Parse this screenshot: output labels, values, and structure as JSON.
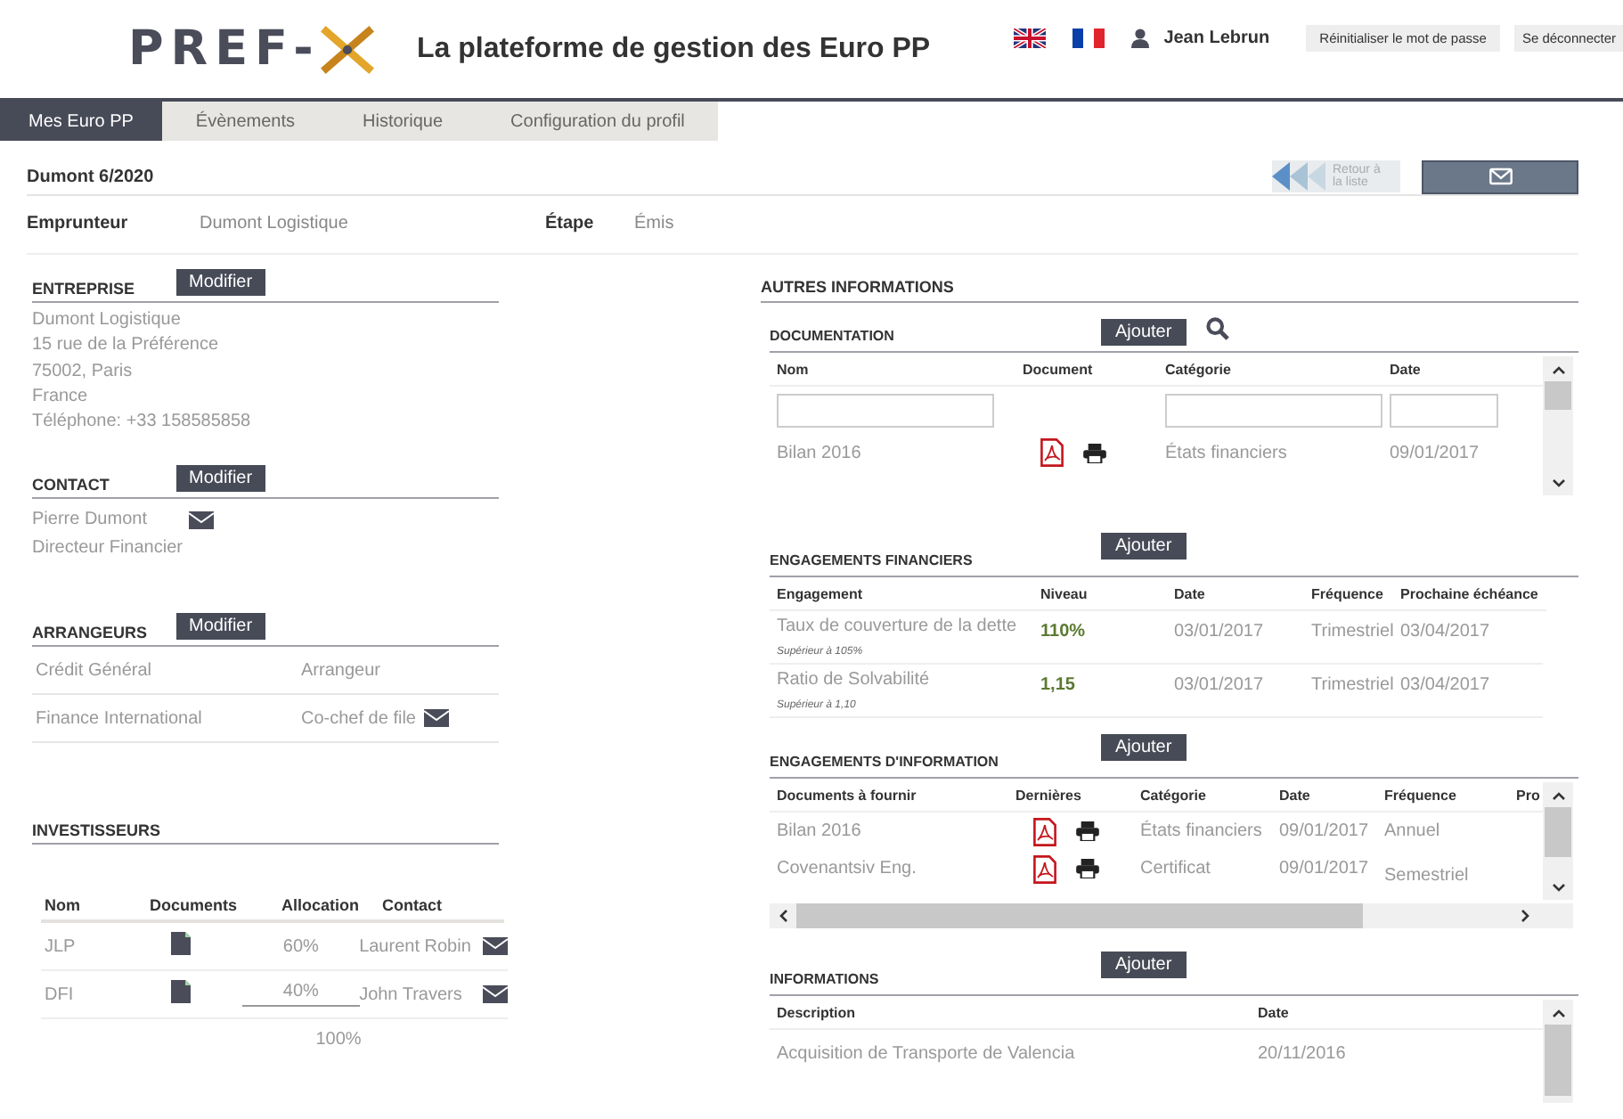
{
  "header": {
    "logo": "PREF-",
    "title": "La plateforme de gestion des Euro PP",
    "user": "Jean Lebrun",
    "buttons": [
      "Réinitialiser le mot de passe",
      "Se déconnecter"
    ]
  },
  "tabs": [
    {
      "label": "Mes Euro PP",
      "selected": true
    },
    {
      "label": "Évènements",
      "selected": false
    },
    {
      "label": "Historique",
      "selected": false
    },
    {
      "label": "Configuration du profil",
      "selected": false
    }
  ],
  "deal": {
    "title": "Dumont 6/2020",
    "back_label": "Retour à la liste",
    "fields": [
      {
        "label": "Emprunteur",
        "value": "Dumont Logistique"
      },
      {
        "label": "Étape",
        "value": "Émis"
      }
    ]
  },
  "entreprise": {
    "title": "ENTREPRISE",
    "button": "Modifier",
    "lines": [
      "Dumont Logistique",
      "15 rue de la Préférence",
      "75002, Paris",
      "France",
      "Téléphone: +33 158585858"
    ]
  },
  "contact": {
    "title": "CONTACT",
    "button": "Modifier",
    "name": "Pierre Dumont",
    "role": "Directeur Financier"
  },
  "arrangeurs": {
    "title": "ARRANGEURS",
    "button": "Modifier",
    "rows": [
      {
        "name": "Crédit Général",
        "role": "Arrangeur",
        "has_email": false
      },
      {
        "name": "Finance International",
        "role": "Co-chef de file",
        "has_email": true
      }
    ]
  },
  "investisseurs": {
    "title": "INVESTISSEURS",
    "columns": [
      "Nom",
      "Documents",
      "Allocation",
      "Contact"
    ],
    "rows": [
      {
        "name": "JLP",
        "allocation": "60%",
        "contact": "Laurent Robin"
      },
      {
        "name": "DFI",
        "allocation": "40%",
        "contact": "John Travers"
      }
    ],
    "total": "100%"
  },
  "autres": {
    "title": "AUTRES INFORMATIONS"
  },
  "documentation": {
    "title": "DOCUMENTATION",
    "button": "Ajouter",
    "columns": [
      "Nom",
      "Document",
      "Catégorie",
      "Date"
    ],
    "rows": [
      {
        "name": "Bilan 2016",
        "category": "États financiers",
        "date": "09/01/2017"
      }
    ]
  },
  "engagements_financiers": {
    "title": "ENGAGEMENTS FINANCIERS",
    "button": "Ajouter",
    "columns": [
      "Engagement",
      "Niveau",
      "Date",
      "Fréquence",
      "Prochaine échéance"
    ],
    "rows": [
      {
        "engagement": "Taux de couverture de la dette",
        "note": "Supérieur à 105%",
        "niveau": "110%",
        "date": "03/01/2017",
        "frequence": "Trimestriel",
        "prochaine": "03/04/2017"
      },
      {
        "engagement": "Ratio de Solvabilité",
        "note": "Supérieur à 1,10",
        "niveau": "1,15",
        "date": "03/01/2017",
        "frequence": "Trimestriel",
        "prochaine": "03/04/2017"
      }
    ]
  },
  "engagements_information": {
    "title": "ENGAGEMENTS D'INFORMATION",
    "button": "Ajouter",
    "columns": [
      "Documents à fournir",
      "Dernières",
      "Catégorie",
      "Date",
      "Fréquence",
      "Pro"
    ],
    "rows": [
      {
        "name": "Bilan 2016",
        "category": "États financiers",
        "date": "09/01/2017",
        "frequence": "Annuel"
      },
      {
        "name": "Covenantsiv Eng.",
        "category": "Certificat",
        "date": "09/01/2017",
        "frequence": "Semestriel"
      }
    ]
  },
  "informations": {
    "title": "INFORMATIONS",
    "button": "Ajouter",
    "columns": [
      "Description",
      "Date"
    ],
    "rows": [
      {
        "description": "Acquisition de Transporte de Valencia",
        "date": "20/11/2016"
      }
    ]
  }
}
